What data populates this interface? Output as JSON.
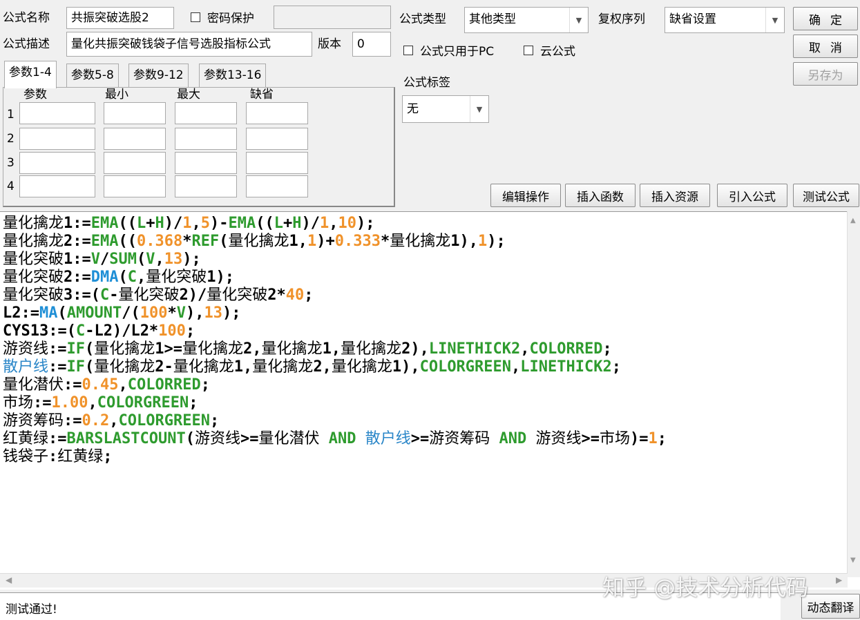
{
  "formula": {
    "name_label": "公式名称",
    "name_value": "共振突破选股2",
    "password_label": "密码保护",
    "desc_label": "公式描述",
    "desc_value": "量化共振突破钱袋子信号选股指标公式",
    "version_label": "版本",
    "version_value": "0",
    "type_label": "公式类型",
    "type_value": "其他类型",
    "rights_label": "复权序列",
    "rights_value": "缺省设置",
    "pc_only_label": "公式只用于PC",
    "cloud_label": "云公式",
    "tags_label": "公式标签",
    "tags_value": "无"
  },
  "buttons": {
    "ok": "确定",
    "cancel": "取消",
    "save_as": "另存为",
    "edit_ops": "编辑操作",
    "insert_func": "插入函数",
    "insert_res": "插入资源",
    "import_formula": "引入公式",
    "test_formula": "测试公式",
    "dynamic_translate": "动态翻译"
  },
  "params": {
    "tabs": [
      "参数1-4",
      "参数5-8",
      "参数9-12",
      "参数13-16"
    ],
    "headers": [
      "参数",
      "最小",
      "最大",
      "缺省"
    ],
    "rows": [
      "1",
      "2",
      "3",
      "4"
    ]
  },
  "colors": {
    "func_green": "#2e9b2e",
    "func_blue": "#1f8fd6",
    "number_orange": "#f0922a",
    "var_blue": "#2a86c8",
    "text": "#000000"
  },
  "code": [
    [
      [
        "量化擒龙1:=",
        "t"
      ],
      [
        "EMA",
        "g"
      ],
      [
        "((",
        "t"
      ],
      [
        "L",
        "g"
      ],
      [
        "+",
        "t"
      ],
      [
        "H",
        "g"
      ],
      [
        ")/",
        "t"
      ],
      [
        "1",
        "n"
      ],
      [
        ",",
        "t"
      ],
      [
        "5",
        "n"
      ],
      [
        ")-",
        "t"
      ],
      [
        "EMA",
        "g"
      ],
      [
        "((",
        "t"
      ],
      [
        "L",
        "g"
      ],
      [
        "+",
        "t"
      ],
      [
        "H",
        "g"
      ],
      [
        ")/",
        "t"
      ],
      [
        "1",
        "n"
      ],
      [
        ",",
        "t"
      ],
      [
        "10",
        "n"
      ],
      [
        ");",
        "t"
      ]
    ],
    [
      [
        "量化擒龙2:=",
        "t"
      ],
      [
        "EMA",
        "g"
      ],
      [
        "((",
        "t"
      ],
      [
        "0.368",
        "n"
      ],
      [
        "*",
        "t"
      ],
      [
        "REF",
        "g"
      ],
      [
        "(量化擒龙1,",
        "t"
      ],
      [
        "1",
        "n"
      ],
      [
        ")+",
        "t"
      ],
      [
        "0.333",
        "n"
      ],
      [
        "*量化擒龙1),",
        "t"
      ],
      [
        "1",
        "n"
      ],
      [
        ");",
        "t"
      ]
    ],
    [
      [
        "量化突破1:=",
        "t"
      ],
      [
        "V",
        "g"
      ],
      [
        "/",
        "t"
      ],
      [
        "SUM",
        "g"
      ],
      [
        "(",
        "t"
      ],
      [
        "V",
        "g"
      ],
      [
        ",",
        "t"
      ],
      [
        "13",
        "n"
      ],
      [
        ");",
        "t"
      ]
    ],
    [
      [
        "量化突破2:=",
        "t"
      ],
      [
        "DMA",
        "b"
      ],
      [
        "(",
        "t"
      ],
      [
        "C",
        "g"
      ],
      [
        ",量化突破1);",
        "t"
      ]
    ],
    [
      [
        "量化突破3:=(",
        "t"
      ],
      [
        "C",
        "g"
      ],
      [
        "-量化突破2)/量化突破2*",
        "t"
      ],
      [
        "40",
        "n"
      ],
      [
        ";",
        "t"
      ]
    ],
    [
      [
        "L2:=",
        "t"
      ],
      [
        "MA",
        "b"
      ],
      [
        "(",
        "t"
      ],
      [
        "AMOUNT",
        "g"
      ],
      [
        "/(",
        "t"
      ],
      [
        "100",
        "n"
      ],
      [
        "*",
        "t"
      ],
      [
        "V",
        "g"
      ],
      [
        "),",
        "t"
      ],
      [
        "13",
        "n"
      ],
      [
        ");",
        "t"
      ]
    ],
    [
      [
        "CYS13:=(",
        "t"
      ],
      [
        "C",
        "g"
      ],
      [
        "-L2)/L2*",
        "t"
      ],
      [
        "100",
        "n"
      ],
      [
        ";",
        "t"
      ]
    ],
    [
      [
        "游资线:=",
        "t"
      ],
      [
        "IF",
        "g"
      ],
      [
        "(量化擒龙1>=量化擒龙2,量化擒龙1,量化擒龙2),",
        "t"
      ],
      [
        "LINETHICK2",
        "g"
      ],
      [
        ",",
        "t"
      ],
      [
        "COLORRED",
        "g"
      ],
      [
        ";",
        "t"
      ]
    ],
    [
      [
        "散户线",
        "v"
      ],
      [
        ":=",
        "t"
      ],
      [
        "IF",
        "g"
      ],
      [
        "(量化擒龙2-量化擒龙1,量化擒龙2,量化擒龙1),",
        "t"
      ],
      [
        "COLORGREEN",
        "g"
      ],
      [
        ",",
        "t"
      ],
      [
        "LINETHICK2",
        "g"
      ],
      [
        ";",
        "t"
      ]
    ],
    [
      [
        "量化潜伏:=",
        "t"
      ],
      [
        "0.45",
        "n"
      ],
      [
        ",",
        "t"
      ],
      [
        "COLORRED",
        "g"
      ],
      [
        ";",
        "t"
      ]
    ],
    [
      [
        "市场:=",
        "t"
      ],
      [
        "1.00",
        "n"
      ],
      [
        ",",
        "t"
      ],
      [
        "COLORGREEN",
        "g"
      ],
      [
        ";",
        "t"
      ]
    ],
    [
      [
        "游资筹码:=",
        "t"
      ],
      [
        "0.2",
        "n"
      ],
      [
        ",",
        "t"
      ],
      [
        "COLORGREEN",
        "g"
      ],
      [
        ";",
        "t"
      ]
    ],
    [
      [
        "红黄绿:=",
        "t"
      ],
      [
        "BARSLASTCOUNT",
        "g"
      ],
      [
        "(游资线>=量化潜伏 ",
        "t"
      ],
      [
        "AND",
        "g"
      ],
      [
        " ",
        "t"
      ],
      [
        "散户线",
        "v"
      ],
      [
        ">=游资筹码 ",
        "t"
      ],
      [
        "AND",
        "g"
      ],
      [
        " 游资线>=市场)=",
        "t"
      ],
      [
        "1",
        "n"
      ],
      [
        ";",
        "t"
      ]
    ],
    [
      [
        "钱袋子:红黄绿;",
        "t"
      ]
    ]
  ],
  "status_text": "测试通过!",
  "watermark": "知乎 @技术分析代码"
}
